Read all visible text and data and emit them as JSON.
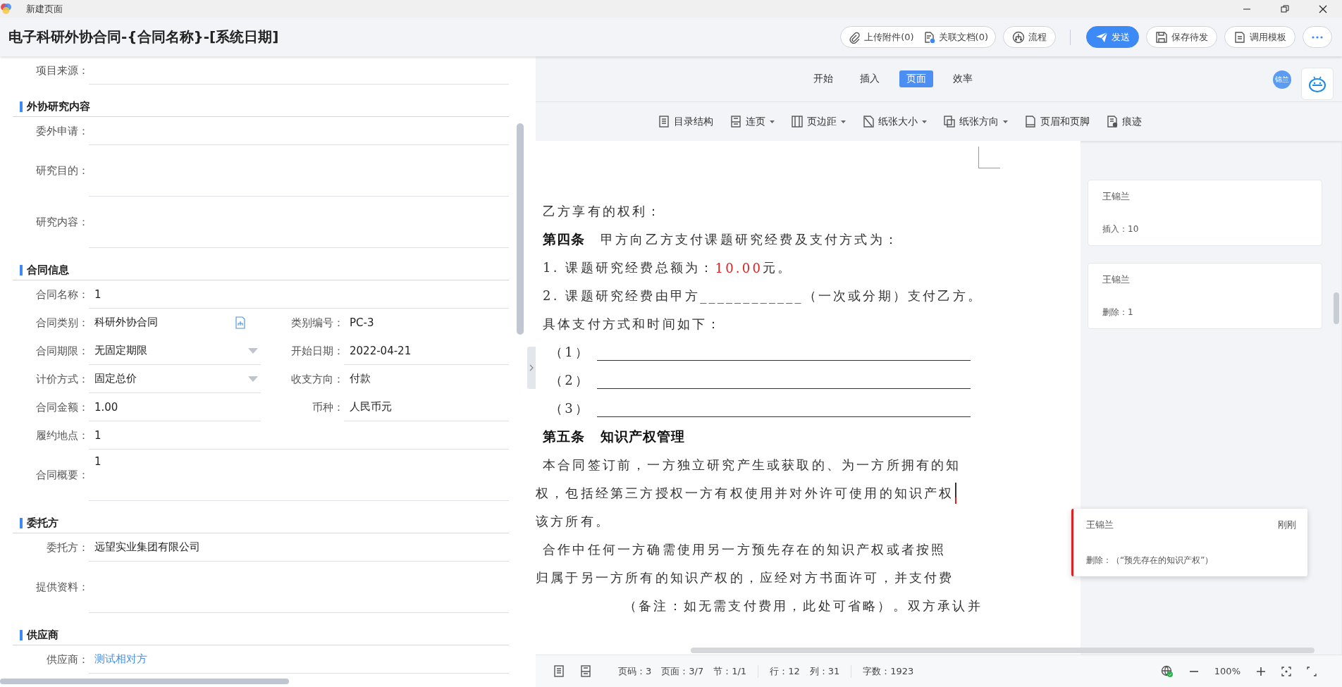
{
  "window": {
    "title": "新建页面"
  },
  "header": {
    "title": "电子科研外协合同-{合同名称}-[系统日期]",
    "actions": [
      {
        "kind": "attach",
        "label": "上传附件(0)"
      },
      {
        "kind": "related",
        "label": "关联文档(0)"
      },
      {
        "kind": "flow",
        "label": "流程"
      },
      {
        "kind": "send",
        "label": "发送"
      },
      {
        "kind": "save",
        "label": "保存待发"
      },
      {
        "kind": "template",
        "label": "调用模板"
      },
      {
        "kind": "more"
      }
    ]
  },
  "form": {
    "items": [
      {
        "kind": "field",
        "label": "项目来源："
      },
      {
        "kind": "section",
        "title": "外协研究内容"
      },
      {
        "kind": "field",
        "label": "委外申请："
      },
      {
        "kind": "area",
        "label": "研究目的："
      },
      {
        "kind": "area",
        "label": "研究内容："
      },
      {
        "kind": "section",
        "title": "合同信息"
      },
      {
        "kind": "field",
        "label": "合同名称：",
        "value": "1"
      },
      {
        "kind": "pair",
        "fields": [
          {
            "label": "合同类别：",
            "value": "科研外协合同",
            "kind": "lookup"
          },
          {
            "label": "类别编号：",
            "value": "PC-3",
            "kind": "plain"
          }
        ]
      },
      {
        "kind": "pair",
        "fields": [
          {
            "label": "合同期限：",
            "value": "无固定期限",
            "kind": "select"
          },
          {
            "label": "开始日期：",
            "value": "2022-04-21",
            "kind": "text"
          }
        ]
      },
      {
        "kind": "pair",
        "fields": [
          {
            "label": "计价方式：",
            "value": "固定总价",
            "kind": "select"
          },
          {
            "label": "收支方向：",
            "value": "付款",
            "kind": "plain"
          }
        ]
      },
      {
        "kind": "pair",
        "fields": [
          {
            "label": "合同金额：",
            "value": "1.00",
            "kind": "text"
          },
          {
            "label": "币种：",
            "value": "人民币元",
            "kind": "text"
          }
        ]
      },
      {
        "kind": "field",
        "label": "履约地点：",
        "value": "1"
      },
      {
        "kind": "area",
        "label": "合同概要：",
        "value": "1"
      },
      {
        "kind": "section",
        "title": "委托方"
      },
      {
        "kind": "field",
        "label": "委托方：",
        "value": "远望实业集团有限公司"
      },
      {
        "kind": "area",
        "label": "提供资料："
      },
      {
        "kind": "section",
        "title": "供应商"
      },
      {
        "kind": "link",
        "label": "供应商：",
        "value": "测试相对方"
      }
    ]
  },
  "doc": {
    "tabs": [
      {
        "label": "开始",
        "selected": false
      },
      {
        "label": "插入",
        "selected": false
      },
      {
        "label": "页面",
        "selected": true
      },
      {
        "label": "效率",
        "selected": false
      }
    ],
    "avatar": "锦兰",
    "ribbon": [
      {
        "kind": "outline",
        "label": "目录结构",
        "dropdown": false
      },
      {
        "kind": "page",
        "label": "连页",
        "dropdown": true
      },
      {
        "kind": "margin",
        "label": "页边距",
        "dropdown": true
      },
      {
        "kind": "size",
        "label": "纸张大小",
        "dropdown": true
      },
      {
        "kind": "orientation",
        "label": "纸张方向",
        "dropdown": true
      },
      {
        "kind": "headerfooter",
        "label": "页眉和页脚",
        "dropdown": false
      },
      {
        "kind": "track",
        "label": "痕迹",
        "dropdown": false
      }
    ],
    "lines": [
      {
        "kind": "text",
        "text": "乙方享有的权利："
      },
      {
        "kind": "article",
        "number": "第四条",
        "text": "甲方向乙方支付课题研究经费及支付方式为："
      },
      {
        "kind": "amount",
        "before": "1. 课题研究经费总额为：",
        "amount": "10.00",
        "after": " 元。"
      },
      {
        "kind": "text",
        "text": "2. 课题研究经费由甲方____________（一次或分期）支付乙方。"
      },
      {
        "kind": "text",
        "text": "具体支付方式和时间如下："
      },
      {
        "kind": "blank",
        "number": "（1）"
      },
      {
        "kind": "blank",
        "number": "（2）"
      },
      {
        "kind": "blank",
        "number": "（3）"
      },
      {
        "kind": "heading",
        "number": "第五条",
        "text": "知识产权管理"
      },
      {
        "kind": "text",
        "text": "本合同签订前，一方独立研究产生或获取的、为一方所拥有的知"
      },
      {
        "kind": "editing",
        "text": "权，包括经第三方授权一方有权使用并对外许可使用的知识产权"
      },
      {
        "kind": "cut",
        "text": "该方所有。"
      },
      {
        "kind": "text",
        "text": "合作中任何一方确需使用另一方预先存在的知识产权或者按照"
      },
      {
        "kind": "cut",
        "text": "归属于另一方所有的知识产权的，应经对方书面许可，并支付费"
      },
      {
        "kind": "tail",
        "text": "（备注：如无需支付费用，此处可省略）。双方承认并"
      }
    ],
    "comments": [
      {
        "kind": "card",
        "author": "王锦兰",
        "action": "插入：10"
      },
      {
        "kind": "card",
        "author": "王锦兰",
        "action": "删除：1"
      },
      {
        "kind": "popup",
        "author": "王锦兰",
        "time": "刚刚",
        "action": "删除：（“预先存在的知识产权”）"
      }
    ]
  },
  "status_bar": {
    "groups": [
      [
        "页码：3",
        "页面：3/7",
        "节：1/1"
      ],
      [
        "行：12",
        "列：31"
      ],
      [
        "字数：1923"
      ]
    ],
    "zoom": "100%"
  }
}
